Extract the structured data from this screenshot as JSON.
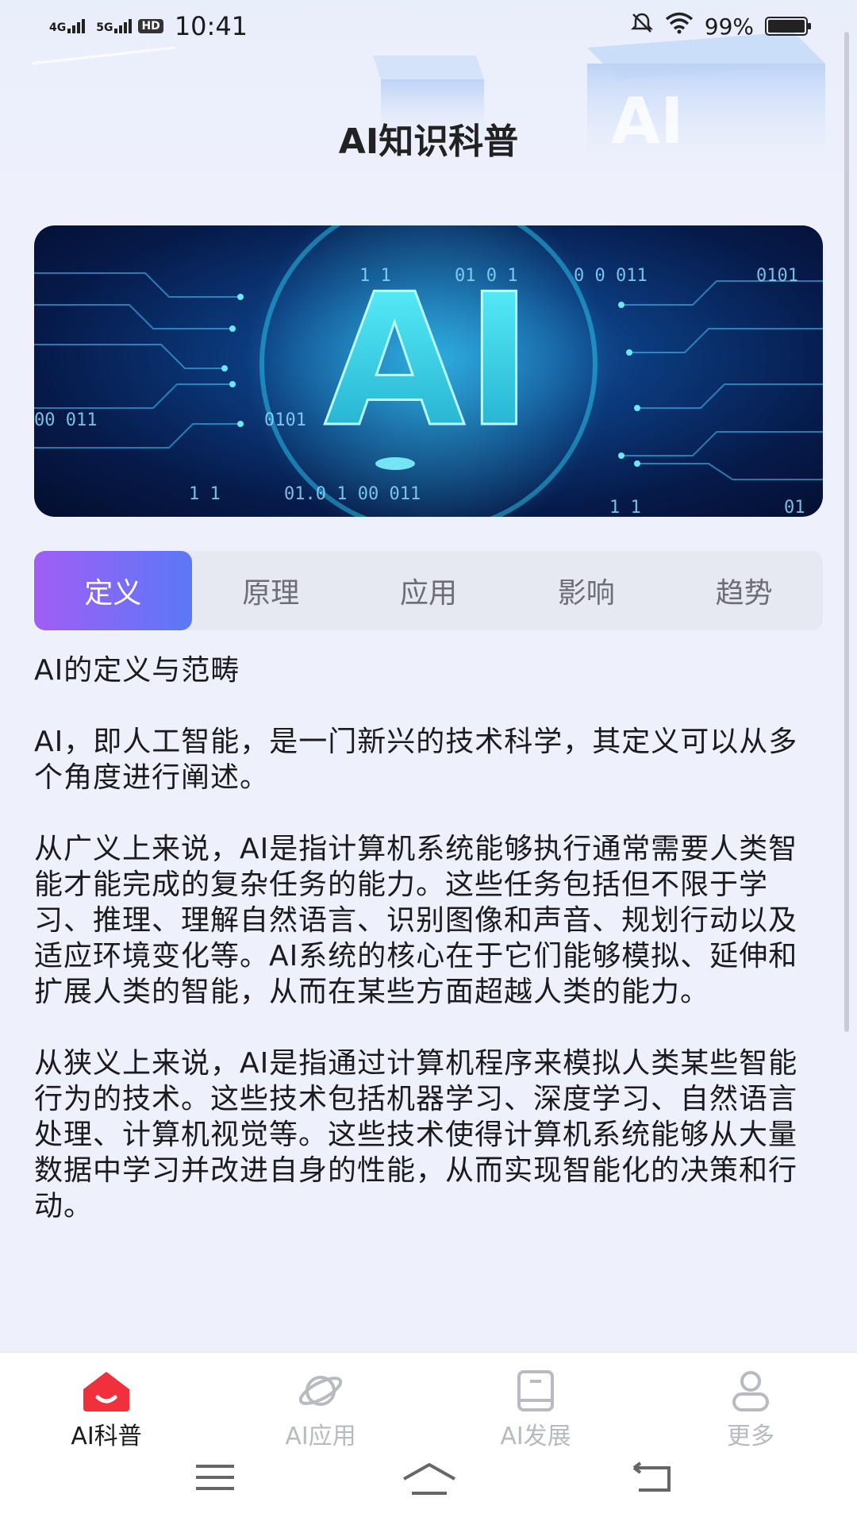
{
  "status_bar": {
    "network1": "4G",
    "network2": "5G",
    "hd": "HD",
    "time": "10:41",
    "battery": "99%",
    "battery_level": 0.99
  },
  "page": {
    "title": "AI知识科普"
  },
  "banner": {
    "big_text": "AI",
    "binary_texts": [
      "1 1",
      "01  0 1",
      "0 0  011",
      "0101",
      "00  011",
      "0101",
      "1 1",
      "01.0  1  00  011",
      "1 1",
      "01"
    ]
  },
  "tabs": [
    {
      "label": "定义",
      "active": true
    },
    {
      "label": "原理",
      "active": false
    },
    {
      "label": "应用",
      "active": false
    },
    {
      "label": "影响",
      "active": false
    },
    {
      "label": "趋势",
      "active": false
    }
  ],
  "content": {
    "heading": "AI的定义与范畴",
    "paragraphs": [
      "AI，即人工智能，是一门新兴的技术科学，其定义可以从多个角度进行阐述。",
      "从广义上来说，AI是指计算机系统能够执行通常需要人类智能才能完成的复杂任务的能力。这些任务包括但不限于学习、推理、理解自然语言、识别图像和声音、规划行动以及适应环境变化等。AI系统的核心在于它们能够模拟、延伸和扩展人类的智能，从而在某些方面超越人类的能力。",
      "从狭义上来说，AI是指通过计算机程序来模拟人类某些智能行为的技术。这些技术包括机器学习、深度学习、自然语言处理、计算机视觉等。这些技术使得计算机系统能够从大量数据中学习并改进自身的性能，从而实现智能化的决策和行动。"
    ]
  },
  "bottom_nav": [
    {
      "label": "AI科普",
      "icon": "home-icon",
      "active": true
    },
    {
      "label": "AI应用",
      "icon": "planet-icon",
      "active": false
    },
    {
      "label": "AI发展",
      "icon": "book-icon",
      "active": false
    },
    {
      "label": "更多",
      "icon": "person-icon",
      "active": false
    }
  ],
  "colors": {
    "accent_gradient_start": "#a05ef5",
    "accent_gradient_end": "#5b78f7",
    "home_icon": "#f0303c",
    "background": "#eef1fc"
  }
}
